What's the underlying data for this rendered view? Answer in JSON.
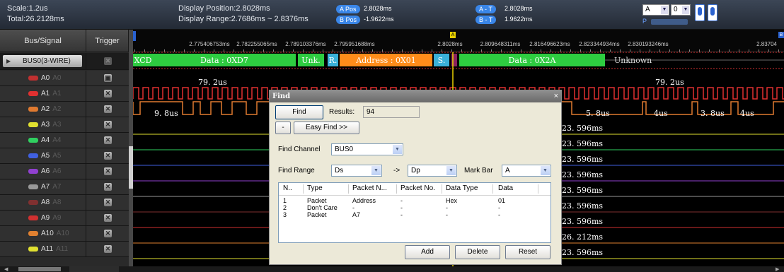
{
  "header": {
    "scale": "Scale:1.2us",
    "total": "Total:26.2128ms",
    "display_position": "Display Position:2.8028ms",
    "display_range": "Display Range:2.7686ms ~ 2.8376ms",
    "a_pos_tag": "A Pos",
    "a_pos_val": "2.8028ms",
    "b_pos_tag": "B Pos",
    "b_pos_val": "-1.9622ms",
    "a_t_tag": "A - T",
    "a_t_val": "2.8028ms",
    "b_t_tag": "B - T",
    "b_t_val": "1.9622ms",
    "sel_a": "A",
    "sel_0": "0",
    "p_label": "P"
  },
  "columns": {
    "bus_signal": "Bus/Signal",
    "trigger": "Trigger"
  },
  "bus": {
    "name": "BUS0(3-WIRE)"
  },
  "channels": [
    {
      "name": "A0",
      "dim": "A0",
      "color": "#c03030"
    },
    {
      "name": "A1",
      "dim": "A1",
      "color": "#e03030"
    },
    {
      "name": "A2",
      "dim": "A2",
      "color": "#e07a30"
    },
    {
      "name": "A3",
      "dim": "A3",
      "color": "#e0e030"
    },
    {
      "name": "A4",
      "dim": "A4",
      "color": "#30d060"
    },
    {
      "name": "A5",
      "dim": "A5",
      "color": "#4060e0"
    },
    {
      "name": "A6",
      "dim": "A6",
      "color": "#9040d0"
    },
    {
      "name": "A7",
      "dim": "A7",
      "color": "#999999"
    },
    {
      "name": "A8",
      "dim": "A8",
      "color": "#803030"
    },
    {
      "name": "A9",
      "dim": "A9",
      "color": "#d03030"
    },
    {
      "name": "A10",
      "dim": "A10",
      "color": "#e08030"
    },
    {
      "name": "A11",
      "dim": "A11",
      "color": "#e0e030"
    }
  ],
  "ruler": {
    "ticks": [
      "2.775406753ms",
      "2.782255065ms",
      "2.789103376ms",
      "2.795951688ms",
      "2.8028ms",
      "2.809648311ms",
      "2.816496623ms",
      "2.823344934ms",
      "2.830193246ms",
      "2.83704"
    ],
    "marker_a": "A",
    "marker_b": "B"
  },
  "bus_decode": [
    "XCD",
    "Data : 0XD7",
    "Unk.",
    "R.",
    "Address : 0X01",
    "S.",
    "Data : 0X2A",
    "Unknown"
  ],
  "measurements": {
    "a0_left": "79. 2us",
    "a0_right": "79. 2us",
    "a2_left": "9. 8us",
    "a2_r1": "5. 8us",
    "a2_r2": "4us",
    "a2_r3": "3. 8us",
    "a2_r4": "4us",
    "right_col": [
      "23. 596ms",
      "23. 596ms",
      "23. 596ms",
      "23. 596ms",
      "23. 596ms",
      "23. 596ms",
      "23. 596ms",
      "26. 212ms",
      "23. 596ms"
    ]
  },
  "find_dialog": {
    "title": "Find",
    "close": "×",
    "find_button": "Find",
    "results_label": "Results:",
    "results_value": "94",
    "minus_button": "-",
    "easy_find_button": "Easy Find >>",
    "find_channel_label": "Find Channel",
    "find_channel_value": "BUS0",
    "find_range_label": "Find Range",
    "range_from": "Ds",
    "arrow": "->",
    "range_to": "Dp",
    "mark_bar_label": "Mark Bar",
    "mark_bar_value": "A",
    "table": {
      "headers": [
        "N..",
        "Type",
        "Packet N...",
        "Packet No.",
        "Data Type",
        "Data"
      ],
      "rows": [
        [
          "1",
          "Packet",
          "Address",
          "-",
          "Hex",
          "01"
        ],
        [
          "2",
          "Don't Care",
          "-",
          "-",
          "-",
          "-"
        ],
        [
          "3",
          "Packet",
          "A7",
          "-",
          "-",
          "-"
        ]
      ]
    },
    "add_button": "Add",
    "delete_button": "Delete",
    "reset_button": "Reset"
  },
  "colors": {
    "bus_green": "#2ecc40",
    "bus_cyan": "#3ab0d8",
    "bus_orange": "#ff8c1a",
    "marker": "#e8d000"
  }
}
